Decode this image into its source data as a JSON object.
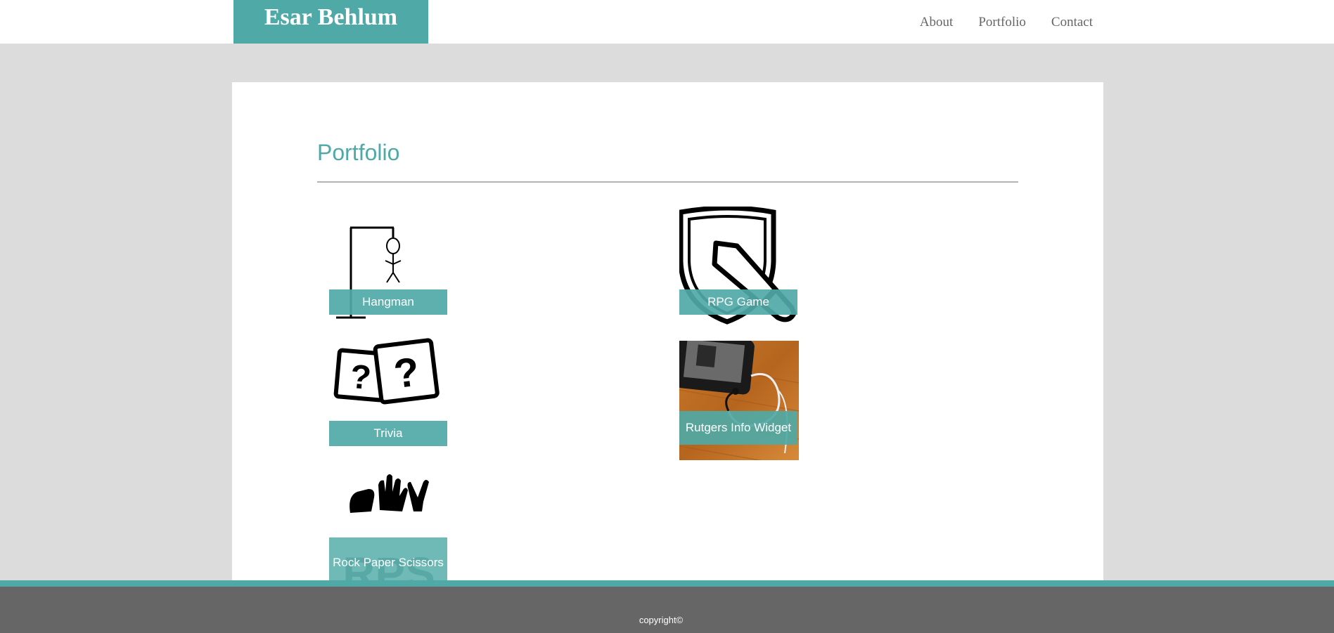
{
  "header": {
    "brand": "Esar Behlum",
    "nav": [
      "About",
      "Portfolio",
      "Contact"
    ]
  },
  "main": {
    "title": "Portfolio",
    "items": [
      {
        "label": "Hangman",
        "icon": "hangman-icon"
      },
      {
        "label": "RPG Game",
        "icon": "shield-sword-icon"
      },
      {
        "label": "Trivia",
        "icon": "question-cards-icon"
      },
      {
        "label": "Rutgers Info Widget",
        "icon": "phone-photo"
      },
      {
        "label": "Rock Paper Scissors",
        "icon": "rps-hands-icon"
      }
    ]
  },
  "footer": {
    "copyright": "copyright©"
  },
  "colors": {
    "accent": "#4fa9a6",
    "background": "#dcdcdc",
    "footer": "#666666"
  }
}
